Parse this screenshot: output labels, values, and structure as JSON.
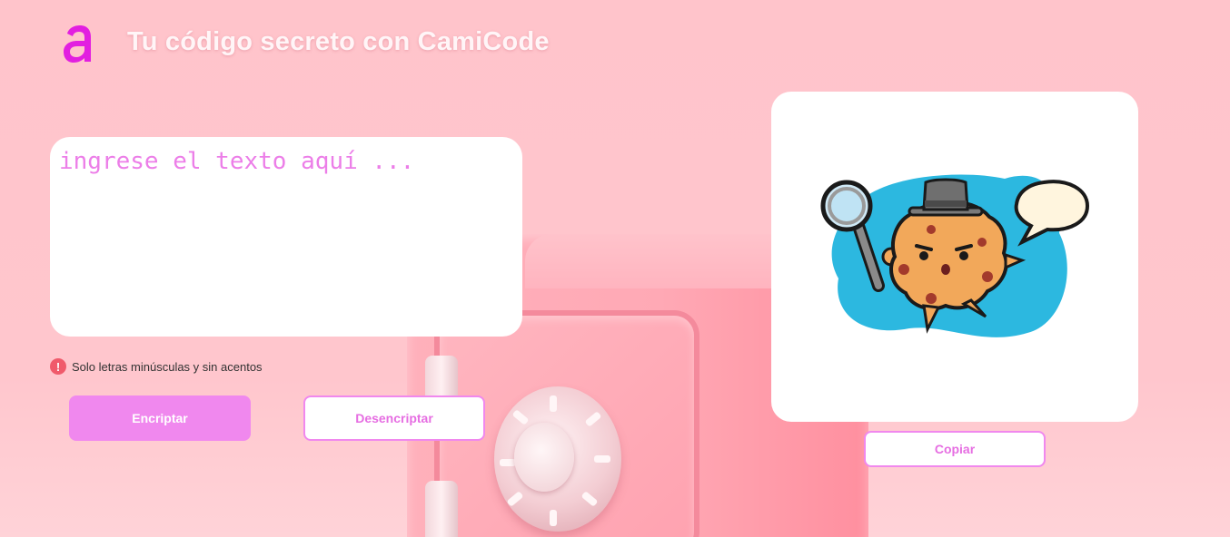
{
  "header": {
    "logo_icon": "camicode-logo-icon",
    "title": "Tu código secreto con CamiCode"
  },
  "input": {
    "placeholder": "ingrese el texto aquí ...",
    "value": ""
  },
  "hint": {
    "icon": "warning-icon",
    "text": "Solo letras minúsculas y sin acentos"
  },
  "actions": {
    "encrypt_label": "Encriptar",
    "decrypt_label": "Desencriptar"
  },
  "output": {
    "illustration": "detective-cookie-icon",
    "copy_label": "Copiar"
  },
  "colors": {
    "background": "#ffc4cb",
    "accent": "#f088ee",
    "logo": "#e21fe0",
    "warning": "#f05a6b"
  }
}
